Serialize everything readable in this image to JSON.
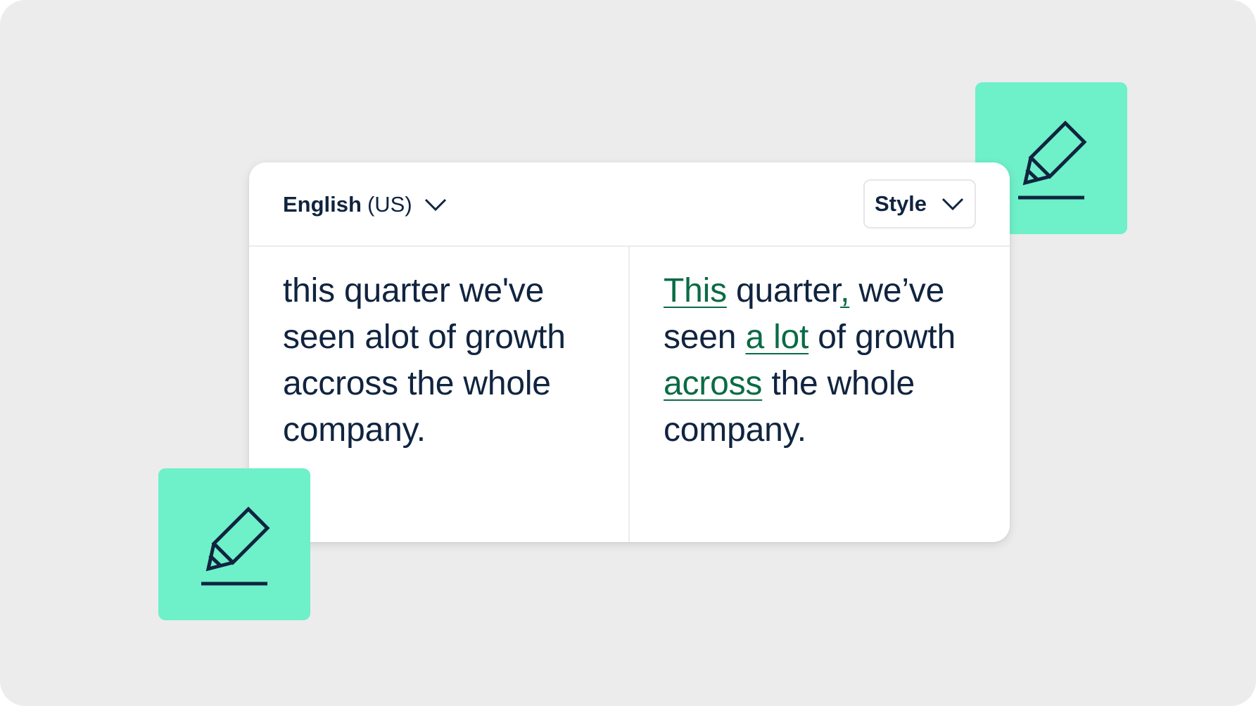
{
  "toolbar": {
    "language_name": "English",
    "language_region": "(US)",
    "style_label": "Style",
    "language_chevron_icon": "chevron-down-icon",
    "style_chevron_icon": "chevron-down-icon"
  },
  "original": {
    "lines": [
      "this quarter we've",
      "seen alot of growth",
      "accross the whole",
      "company."
    ]
  },
  "corrected": {
    "line1": {
      "fix1": "This",
      "text1": " quarter",
      "fix2": ",",
      "text2": " we’ve"
    },
    "line2": {
      "text1": "seen ",
      "fix1": "a lot",
      "text2": " of growth"
    },
    "line3": {
      "fix1": "across",
      "text1": " the whole"
    },
    "line4": {
      "text1": "company."
    }
  },
  "decorations": {
    "top_icon": "pencil-edit-icon",
    "bottom_icon": "pencil-edit-icon"
  },
  "colors": {
    "background": "#ececec",
    "card": "#ffffff",
    "accent_tile": "#6ef0c9",
    "text": "#10243f",
    "correction": "#0a6b45"
  }
}
